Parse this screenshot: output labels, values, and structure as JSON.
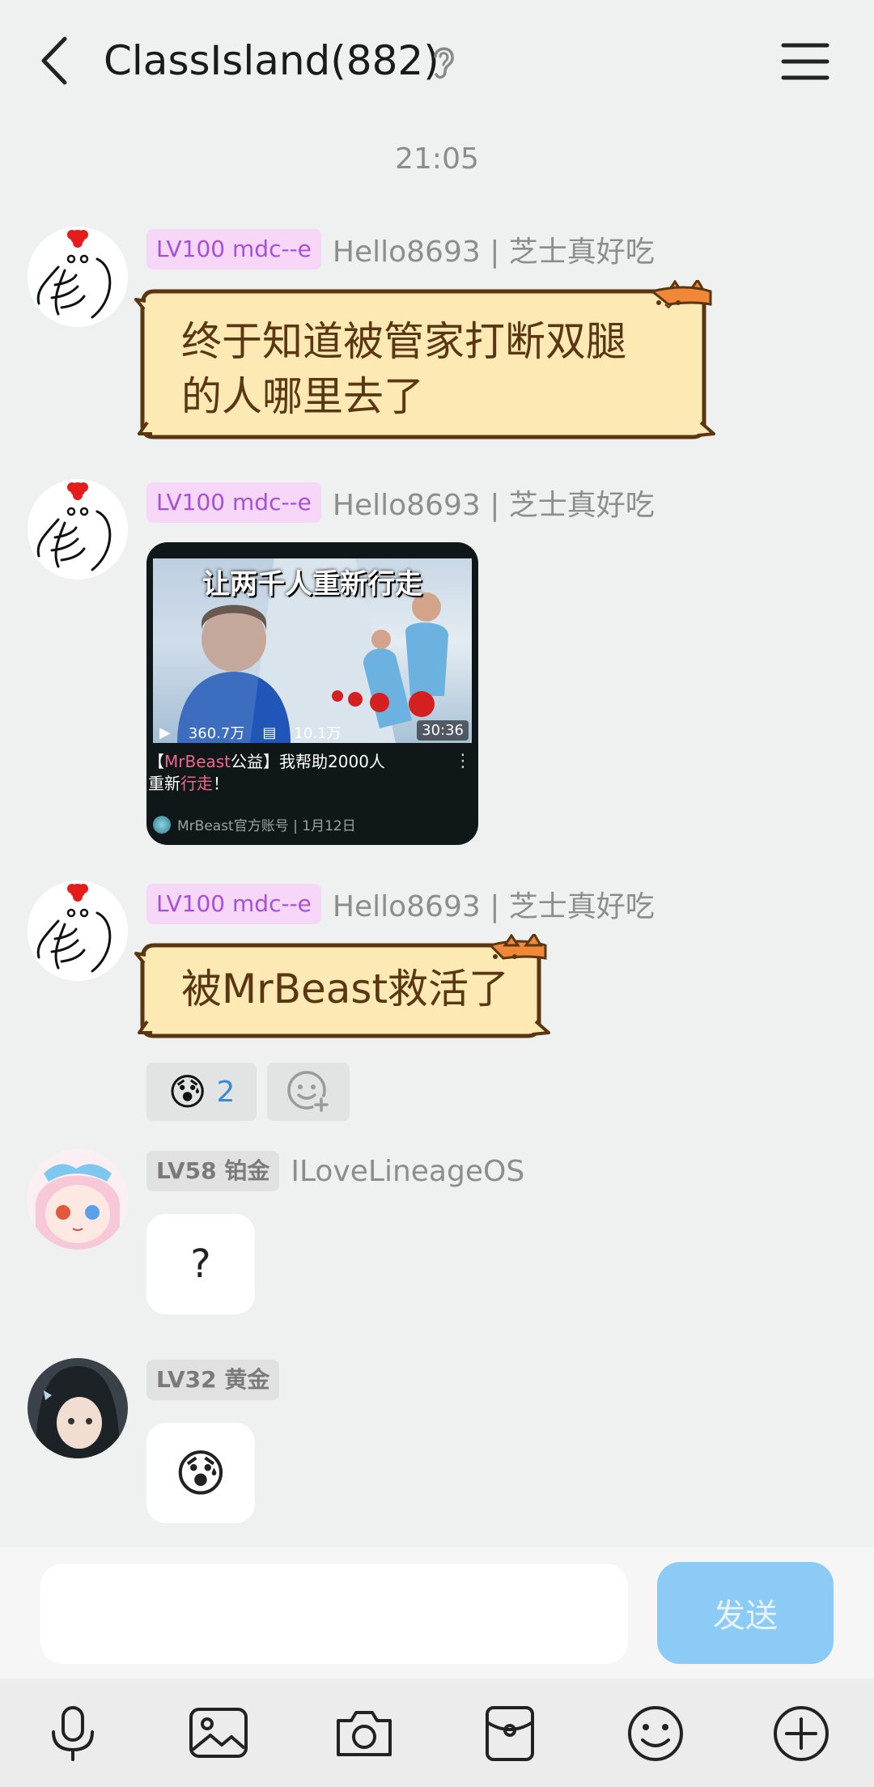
{
  "header": {
    "title": "ClassIsland(882)"
  },
  "time_separator": "21:05",
  "messages": [
    {
      "badge": "LV100 mdc--e",
      "sender": "Hello8693 | 芝士真好吃",
      "lines": [
        "终于知道被管家打断双腿",
        "的人哪里去了"
      ]
    },
    {
      "badge": "LV100 mdc--e",
      "sender": "Hello8693 | 芝士真好吃",
      "video": {
        "thumb_caption": "让两千人重新行走",
        "views": "360.7万",
        "comments": "10.1万",
        "duration": "30:36",
        "title_open": "【",
        "title_hl1": "MrBeast",
        "title_mid": "公益】我帮助2000人",
        "title_line2a": "重新",
        "title_hl2": "行走",
        "title_end": "！",
        "channel": "MrBeast官方账号 | 1月12日"
      }
    },
    {
      "badge": "LV100 mdc--e",
      "sender": "Hello8693 | 芝士真好吃",
      "text": "被MrBeast救活了",
      "reaction": {
        "emoji": "😰",
        "count": "2"
      }
    },
    {
      "badge": "LV58 铂金",
      "sender": "ILoveLineageOS",
      "text": "?"
    },
    {
      "badge": "LV32 黄金",
      "sender": "",
      "text": "😰"
    }
  ],
  "input": {
    "placeholder": "",
    "send_label": "发送"
  },
  "toolbar": [
    "microphone-icon",
    "image-icon",
    "camera-icon",
    "red-packet-icon",
    "emoji-icon",
    "plus-icon"
  ]
}
